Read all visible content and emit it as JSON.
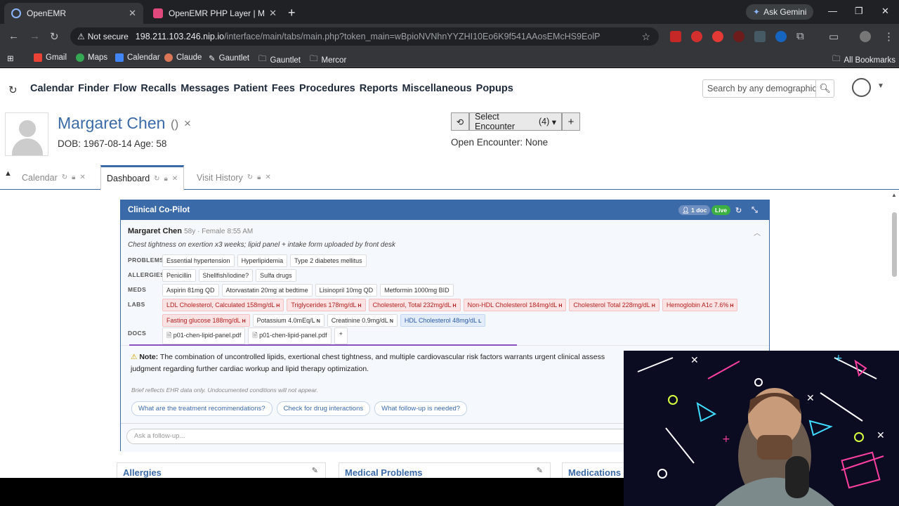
{
  "browser": {
    "tabs": [
      {
        "title": "OpenEMR",
        "active": true
      },
      {
        "title": "OpenEMR PHP Layer | Mermaid",
        "active": false
      }
    ],
    "new_tab": "+",
    "gemini_label": "Ask Gemini",
    "security_label": "Not secure",
    "url_host": "198.211.103.246.nip.io",
    "url_path": "/interface/main/tabs/main.php?token_main=wBpioNVNhnYYZHI10Eo6K9f541AAosEMcHS9EolP",
    "bookmarks": [
      "Gmail",
      "Maps",
      "Calendar",
      "Claude",
      "Gauntlet",
      "Gauntlet",
      "Mercor"
    ],
    "all_bookmarks": "All Bookmarks"
  },
  "emr_nav": {
    "menu": [
      "Calendar",
      "Finder",
      "Flow",
      "Recalls",
      "Messages",
      "Patient",
      "Fees",
      "Procedures",
      "Reports",
      "Miscellaneous",
      "Popups"
    ],
    "search_placeholder": "Search by any demographic"
  },
  "patient": {
    "name": "Margaret Chen",
    "paren": "()",
    "close": "×",
    "dob_line": "DOB: 1967-08-14 Age: 58"
  },
  "encounter": {
    "select_label": "Select Encounter",
    "count": "(4)",
    "open_label": "Open Encounter: None"
  },
  "patient_tabs": [
    "Calendar",
    "Dashboard",
    "Visit History"
  ],
  "copilot": {
    "title": "Clinical Co-Pilot",
    "doc_badge": "1 doc",
    "live_badge": "Live",
    "patient_name": "Margaret Chen",
    "patient_meta": "58y · Female",
    "time": "8:55 AM",
    "complaint": "Chest tightness on exertion x3 weeks; lipid panel + intake form uploaded by front desk",
    "labels": {
      "problems": "PROBLEMS",
      "allergies": "ALLERGIES",
      "meds": "MEDS",
      "labs": "LABS",
      "docs": "DOCS"
    },
    "problems": [
      "Essential hypertension",
      "Hyperlipidemia",
      "Type 2 diabetes mellitus"
    ],
    "allergies": [
      "Penicillin",
      "Shellfish/iodine?",
      "Sulfa drugs"
    ],
    "meds": [
      "Aspirin 81mg QD",
      "Atorvastatin 20mg at bedtime",
      "Lisinopril 10mg QD",
      "Metformin 1000mg BID"
    ],
    "labs": [
      {
        "text": "LDL Cholesterol, Calculated 158mg/dL",
        "flag": "H",
        "status": "high"
      },
      {
        "text": "Triglycerides 178mg/dL",
        "flag": "H",
        "status": "high"
      },
      {
        "text": "Cholesterol, Total 232mg/dL",
        "flag": "H",
        "status": "high"
      },
      {
        "text": "Non-HDL Cholesterol 184mg/dL",
        "flag": "H",
        "status": "high"
      },
      {
        "text": "Cholesterol Total 228mg/dL",
        "flag": "H",
        "status": "high"
      },
      {
        "text": "Hemoglobin A1c 7.6%",
        "flag": "H",
        "status": "high"
      },
      {
        "text": "Fasting glucose 188mg/dL",
        "flag": "H",
        "status": "high"
      },
      {
        "text": "Potassium 4.0mEq/L",
        "flag": "N",
        "status": "normal"
      },
      {
        "text": "Creatinine 0.9mg/dL",
        "flag": "N",
        "status": "normal"
      },
      {
        "text": "HDL Cholesterol 48mg/dL",
        "flag": "L",
        "status": "low"
      }
    ],
    "docs": [
      "p01-chen-lipid-panel.pdf",
      "p01-chen-lipid-panel.pdf"
    ],
    "docs_add": "+",
    "note_label": "Note:",
    "note_text": "The combination of uncontrolled lipids, exertional chest tightness, and multiple cardiovascular risk factors warrants urgent clinical assess judgment regarding further cardiac workup and lipid therapy optimization.",
    "brief": "Brief reflects EHR data only. Undocumented conditions will not appear.",
    "suggestions": [
      "What are the treatment recommendations?",
      "Check for drug interactions",
      "What follow-up is needed?"
    ],
    "ask_placeholder": "Ask a follow-up..."
  },
  "cards": [
    "Allergies",
    "Medical Problems",
    "Medications"
  ],
  "colors": {
    "primary": "#3b6aa8",
    "high": "#b21f1f",
    "low": "#2d5ba8",
    "live": "#3cb043"
  }
}
